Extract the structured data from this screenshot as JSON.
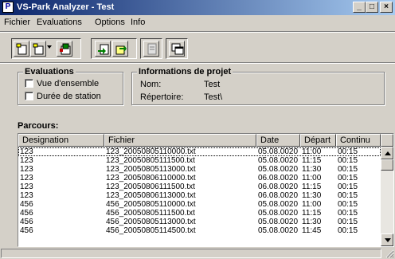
{
  "window": {
    "title": "VS-Park Analyzer - Test",
    "app_icon_glyph": "P",
    "minimize_glyph": "_",
    "maximize_glyph": "□",
    "close_glyph": "×"
  },
  "menu": {
    "items": [
      "Fichier",
      "Evaluations",
      "Options",
      "Info"
    ]
  },
  "toolbar": {
    "icons": [
      "new-document-icon",
      "open-document-icon",
      "save-document-icon",
      "import-data-icon",
      "export-data-icon",
      "page-icon",
      "windows-icon"
    ]
  },
  "evaluations": {
    "title": "Evaluations",
    "options": [
      "Vue d'ensemble",
      "Durée de station"
    ]
  },
  "project_info": {
    "title": "Informations de projet",
    "name_label": "Nom:",
    "name_value": "Test",
    "dir_label": "Répertoire:",
    "dir_value": "Test\\"
  },
  "parcours": {
    "label": "Parcours:",
    "columns": [
      "Designation",
      "Fichier",
      "Date",
      "Départ",
      "Continu"
    ],
    "rows": [
      [
        "123",
        "123_20050805110000.txt",
        "05.08.0020",
        "11:00",
        "00:15"
      ],
      [
        "123",
        "123_20050805111500.txt",
        "05.08.0020",
        "11:15",
        "00:15"
      ],
      [
        "123",
        "123_20050805113000.txt",
        "05.08.0020",
        "11:30",
        "00:15"
      ],
      [
        "123",
        "123_20050806110000.txt",
        "06.08.0020",
        "11:00",
        "00:15"
      ],
      [
        "123",
        "123_20050806111500.txt",
        "06.08.0020",
        "11:15",
        "00:15"
      ],
      [
        "123",
        "123_20050806113000.txt",
        "06.08.0020",
        "11:30",
        "00:15"
      ],
      [
        "456",
        "456_20050805110000.txt",
        "05.08.0020",
        "11:00",
        "00:15"
      ],
      [
        "456",
        "456_20050805111500.txt",
        "05.08.0020",
        "11:15",
        "00:15"
      ],
      [
        "456",
        "456_20050805113000.txt",
        "05.08.0020",
        "11:30",
        "00:15"
      ],
      [
        "456",
        "456_20050805114500.txt",
        "05.08.0020",
        "11:45",
        "00:15"
      ]
    ]
  }
}
